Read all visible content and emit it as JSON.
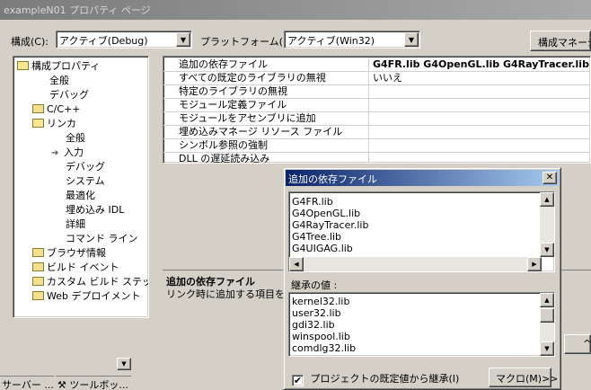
{
  "window": {
    "title": "exampleN01 プロパティ ページ"
  },
  "toolbar": {
    "config_label": "構成(C):",
    "config_value": "アクティブ(Debug)",
    "platform_label": "プラットフォーム(P):",
    "platform_value": "アクティブ(Win32)",
    "config_manager_label": "構成マネージャ"
  },
  "tree": {
    "root": "構成プロパティ",
    "items": [
      "全般",
      "デバッグ",
      "C/C++",
      "リンカ",
      "全般",
      "入力",
      "デバッグ",
      "システム",
      "最適化",
      "埋め込み IDL",
      "詳細",
      "コマンド ライン",
      "ブラウザ情報",
      "ビルド イベント",
      "カスタム ビルド ステップ",
      "Web デプロイメント"
    ]
  },
  "grid": {
    "rows": [
      {
        "name": "追加の依存ファイル",
        "value": "G4FR.lib G4OpenGL.lib G4RayTracer.lib G"
      },
      {
        "name": "すべての既定のライブラリの無視",
        "value": "いいえ"
      },
      {
        "name": "特定のライブラリの無視",
        "value": ""
      },
      {
        "name": "モジュール定義ファイル",
        "value": ""
      },
      {
        "name": "モジュールをアセンブリに追加",
        "value": ""
      },
      {
        "name": "埋め込みマネージ リソース ファイル",
        "value": ""
      },
      {
        "name": "シンボル参照の強制",
        "value": ""
      },
      {
        "name": "DLL の遅延読み込み",
        "value": ""
      }
    ]
  },
  "description": {
    "title": "追加の依存ファイル",
    "text": "リンク時に追加する項目を指"
  },
  "popup": {
    "title": "追加の依存ファイル",
    "close": "✕",
    "items": [
      "G4FR.lib",
      "G4OpenGL.lib",
      "G4RayTracer.lib",
      "G4Tree.lib",
      "G4UIGAG.lib"
    ],
    "inherited_label": "継承の値 :",
    "inherited": [
      "kernel32.lib",
      "user32.lib",
      "gdi32.lib",
      "winspool.lib",
      "comdlg32.lib"
    ],
    "inherit_checkbox_label": "プロジェクトの既定値から継承(I)",
    "inherit_checked": true,
    "macro_button": "マクロ(M)>>"
  },
  "bottom": {
    "tab_server": "サーバー ...",
    "tab_toolbox": "ツールボッ..."
  }
}
